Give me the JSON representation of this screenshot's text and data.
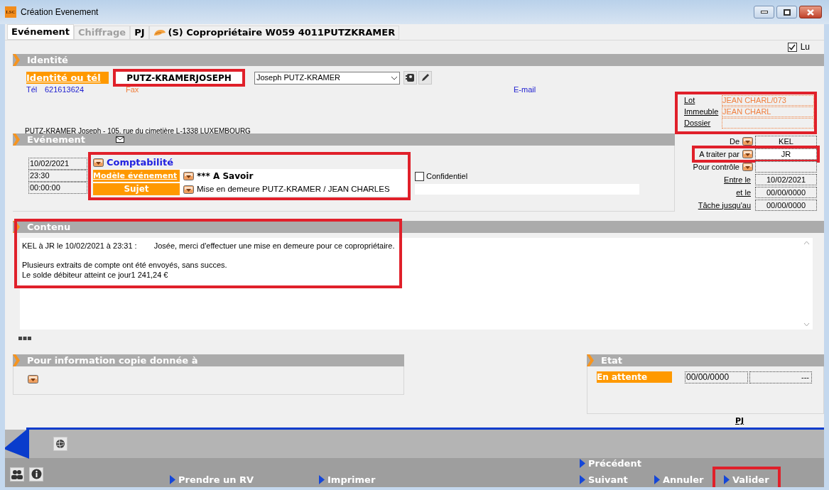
{
  "window": {
    "title": "Création Evenement",
    "app_icon": "LSC"
  },
  "tabs": [
    {
      "label": "Evénement",
      "selected": true,
      "disabled": false,
      "kind": "plain"
    },
    {
      "label": "Chiffrage",
      "selected": false,
      "disabled": true,
      "kind": "plain"
    },
    {
      "label": "PJ",
      "selected": false,
      "disabled": false,
      "kind": "plain"
    },
    {
      "label": "(S) Copropriétaire W059 4011PUTZKRAMER",
      "selected": false,
      "disabled": false,
      "kind": "owner"
    }
  ],
  "lu": {
    "label": "Lu",
    "checked": true
  },
  "identite": {
    "title": "Identité",
    "label": "Identité ou tél",
    "name": "PUTZ-KRAMERJOSEPH",
    "name_highlighted": true,
    "contact": "Joseph PUTZ-KRAMER",
    "tel_label": "Tél",
    "tel": "621613624",
    "fax_label": "Fax",
    "email_label": "E-mail",
    "address": "PUTZ-KRAMER Joseph - 105, rue du cimetière L-1338 LUXEMBOURG"
  },
  "references": {
    "highlighted": true,
    "rows": [
      {
        "label": "Lot",
        "value": "JEAN CHARL/073"
      },
      {
        "label": "Immeuble",
        "value": "JEAN CHARL"
      },
      {
        "label": "Dossier"
      }
    ]
  },
  "evenement": {
    "title": "Evénement",
    "date": "10/02/2021",
    "time": "23:30",
    "duration": "00:00:00",
    "highlighted": true,
    "category": "Comptabilité",
    "model_label": "Modèle événement",
    "model": "*** A Savoir",
    "subject_label": "Sujet",
    "subject": "Mise en demeure PUTZ-KRAMER / JEAN CHARLES",
    "confidential": {
      "label": "Confidentiel",
      "checked": false
    }
  },
  "assignment": [
    {
      "label": "De",
      "kind": "picker",
      "value": "KEL",
      "highlighted": false
    },
    {
      "label": "A traiter par",
      "kind": "picker",
      "value": "JR",
      "highlighted": true
    },
    {
      "label": "Pour contrôle",
      "kind": "picker",
      "highlighted": false
    },
    {
      "label": "Entre le",
      "kind": "link",
      "value": "10/02/2021",
      "highlighted": false
    },
    {
      "label": "et le",
      "kind": "link",
      "value": "00/00/0000",
      "highlighted": false
    },
    {
      "label": "Tâche jusqu'au",
      "kind": "link",
      "value": "00/00/0000",
      "highlighted": false
    }
  ],
  "contenu": {
    "title": "Contenu",
    "highlighted": true,
    "author_line": "KEL à JR le 10/02/2021 à 23:31 :",
    "message": "Josée, merci d'effectuer une mise en demeure pour ce copropriétaire.",
    "paragraphs": [
      "Plusieurs extraits de compte ont été envoyés, sans succes.",
      "Le solde débiteur atteint ce jour1 241,24 €"
    ]
  },
  "copie": {
    "title": "Pour information copie donnée à"
  },
  "etat": {
    "title": "Etat",
    "status": "En attente",
    "date": "00/00/0000",
    "value": "---"
  },
  "pj_link": "PJ",
  "actions": [
    {
      "label": "Prendre un RV",
      "highlighted": false
    },
    {
      "label": "Imprimer",
      "highlighted": false
    },
    {
      "label": "Précédent",
      "highlighted": false
    },
    {
      "label": "Suivant",
      "highlighted": false
    },
    {
      "label": "Annuler",
      "highlighted": false
    },
    {
      "label": "Valider",
      "highlighted": true
    }
  ]
}
